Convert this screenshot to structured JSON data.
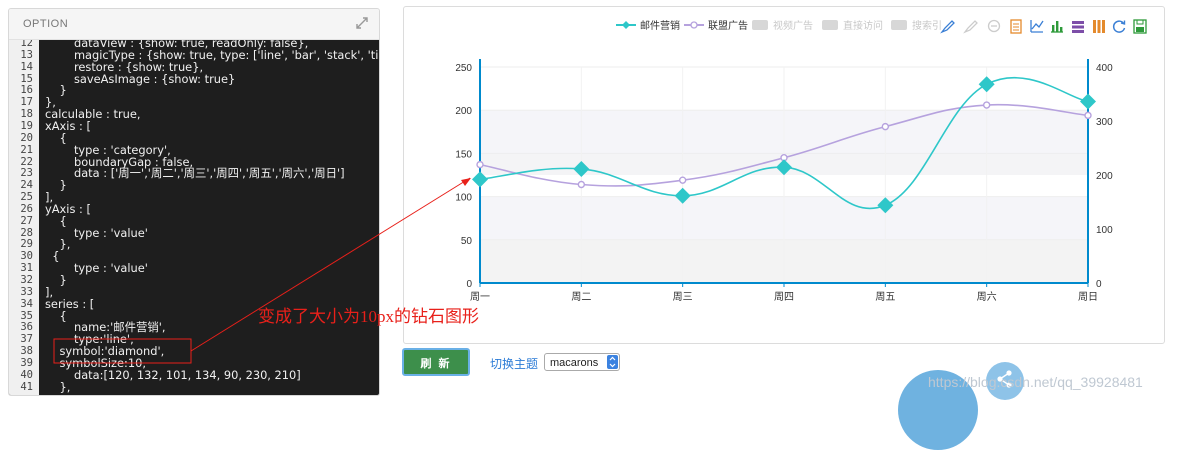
{
  "option_panel": {
    "title": "OPTION",
    "code_lines": [
      {
        "n": "12",
        "t": "        dataView : {show: true, readOnly: false},"
      },
      {
        "n": "13",
        "t": "        magicType : {show: true, type: ['line', 'bar', 'stack', 'tiled'"
      },
      {
        "n": "14",
        "t": "        restore : {show: true},"
      },
      {
        "n": "15",
        "t": "        saveAsImage : {show: true}"
      },
      {
        "n": "16",
        "t": "    }"
      },
      {
        "n": "17",
        "t": "},"
      },
      {
        "n": "18",
        "t": "calculable : true,"
      },
      {
        "n": "19",
        "t": "xAxis : ["
      },
      {
        "n": "20",
        "t": "    {"
      },
      {
        "n": "21",
        "t": "        type : 'category',"
      },
      {
        "n": "22",
        "t": "        boundaryGap : false,"
      },
      {
        "n": "23",
        "t": "        data : ['周一','周二','周三','周四','周五','周六','周日']"
      },
      {
        "n": "24",
        "t": "    }"
      },
      {
        "n": "25",
        "t": "],"
      },
      {
        "n": "26",
        "t": "yAxis : ["
      },
      {
        "n": "27",
        "t": "    {"
      },
      {
        "n": "28",
        "t": "        type : 'value'"
      },
      {
        "n": "29",
        "t": "    },"
      },
      {
        "n": "30",
        "t": "  {"
      },
      {
        "n": "31",
        "t": "        type : 'value'"
      },
      {
        "n": "32",
        "t": "    }"
      },
      {
        "n": "33",
        "t": "],"
      },
      {
        "n": "34",
        "t": "series : ["
      },
      {
        "n": "35",
        "t": "    {"
      },
      {
        "n": "36",
        "t": "        name:'邮件营销',"
      },
      {
        "n": "37",
        "t": "        type:'line',"
      },
      {
        "n": "38",
        "t": "    symbol:'diamond',"
      },
      {
        "n": "39",
        "t": "    symbolSize:10,"
      },
      {
        "n": "40",
        "t": "        data:[120, 132, 101, 134, 90, 230, 210]"
      },
      {
        "n": "41",
        "t": "    },"
      }
    ]
  },
  "annotation": {
    "text": "变成了大小为10px的钻石图形",
    "color": "#e8201a"
  },
  "chart": {
    "legend": [
      "邮件营销",
      "联盟广告",
      "视频广告",
      "直接访问",
      "搜索引"
    ],
    "toolbox_icons": [
      "mark-icon",
      "mark-undo-icon",
      "mark-clear-icon",
      "data-view-icon",
      "line-chart-icon",
      "bar-chart-icon",
      "stack-icon",
      "tiled-icon",
      "restore-icon",
      "save-image-icon"
    ]
  },
  "chart_data": {
    "type": "line",
    "categories": [
      "周一",
      "周二",
      "周三",
      "周四",
      "周五",
      "周六",
      "周日"
    ],
    "ylim": [
      0,
      250
    ],
    "y_ticks": [
      "250",
      "200",
      "150",
      "100",
      "50",
      "0"
    ],
    "y2lim": [
      0,
      400
    ],
    "y2_ticks": [
      "400",
      "300",
      "200",
      "100",
      "0"
    ],
    "series": [
      {
        "name": "邮件营销",
        "axis": "left",
        "symbol": "diamond",
        "smooth": true,
        "color": "#2ec7c9",
        "values": [
          120,
          132,
          101,
          134,
          90,
          230,
          210
        ]
      },
      {
        "name": "联盟广告",
        "axis": "left",
        "symbol": "emptyCircle",
        "smooth": true,
        "color": "#b6a2de",
        "values": [
          137,
          114,
          119,
          145,
          181,
          206,
          194
        ]
      }
    ],
    "legend_position": "top-right"
  },
  "controls": {
    "refresh_label": "刷 新",
    "theme_label": "切换主题",
    "theme_value": "macarons"
  },
  "watermark": "https://blog.csdn.net/qq_39928481",
  "colors": {
    "accent": "#2ec7c9",
    "secondary": "#b6a2de",
    "axis": "#008acd",
    "button": "#3d8f4b"
  }
}
